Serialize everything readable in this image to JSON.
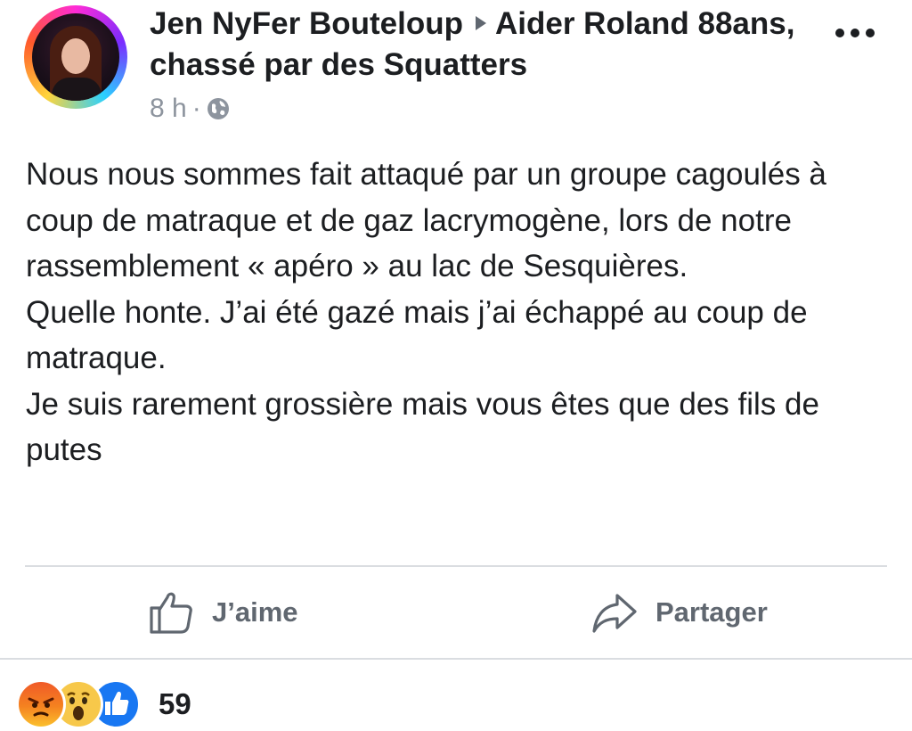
{
  "post": {
    "author": "Jen NyFer Bouteloup",
    "group": "Aider Roland 88ans, chassé par des Squatters",
    "time": "8 h",
    "separator": "·",
    "privacy_icon": "globe-icon",
    "body": "Nous nous sommes fait attaqué par un groupe cagoulés à coup de matraque et de gaz lacrymogène, lors de notre rassemblement « apéro » au lac de Sesquières.\nQuelle honte. J’ai été gazé mais j’ai échappé au coup de matraque.\nJe suis rarement grossière mais vous êtes que des fils de putes"
  },
  "actions": {
    "like_label": "J’aime",
    "share_label": "Partager"
  },
  "reactions": {
    "icons": [
      "angry-reaction-icon",
      "wow-reaction-icon",
      "like-reaction-icon"
    ],
    "count": "59"
  },
  "colors": {
    "text": "#1c1e21",
    "secondary": "#606770",
    "meta": "#8d949e",
    "like_blue": "#1877f2"
  }
}
